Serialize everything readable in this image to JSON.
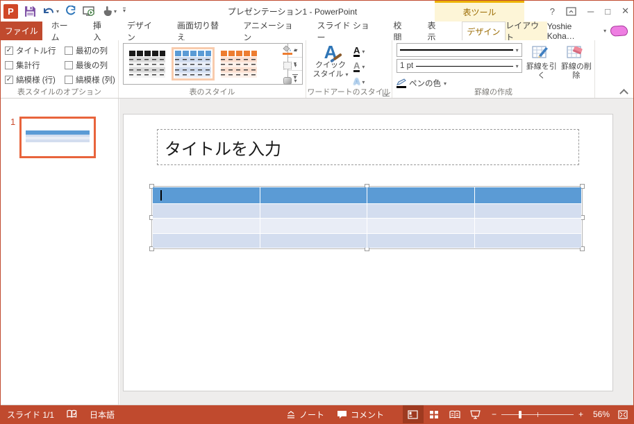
{
  "window": {
    "title": "プレゼンテーション1 - PowerPoint",
    "contextual_title": "表ツール",
    "user_name": "Yoshie Koha…",
    "controls": {
      "help": "?",
      "minimize": "─",
      "maximize": "□",
      "close": "✕"
    }
  },
  "icons": {
    "app": "P",
    "dropdown_arrow": "▾",
    "gallery_up": "▲",
    "gallery_down": "▼",
    "gallery_more": "▼"
  },
  "tabs": {
    "file": "ファイル",
    "items": [
      "ホーム",
      "挿入",
      "デザイン",
      "画面切り替え",
      "アニメーション",
      "スライド ショー",
      "校閲",
      "表示"
    ],
    "contextual_design": "デザイン",
    "contextual_layout": "レイアウト"
  },
  "ribbon": {
    "table_style_options": {
      "label": "表スタイルのオプション",
      "checkboxes": [
        {
          "label": "タイトル行",
          "glyph": "✓"
        },
        {
          "label": "最初の列",
          "glyph": ""
        },
        {
          "label": "集計行",
          "glyph": ""
        },
        {
          "label": "最後の列",
          "glyph": ""
        },
        {
          "label": "縞模様 (行)",
          "glyph": "✓"
        },
        {
          "label": "縞模様 (列)",
          "glyph": ""
        }
      ]
    },
    "table_styles": {
      "label": "表のスタイル",
      "styles": [
        {
          "name": "table-style-dark",
          "header": "#1a1a1a",
          "row_a": "#d9d9d9",
          "row_b": "#f4f4f4",
          "selected": false
        },
        {
          "name": "table-style-blue",
          "header": "#5b9bd5",
          "row_a": "#cfdbee",
          "row_b": "#e9eef8",
          "selected": true
        },
        {
          "name": "table-style-orange",
          "header": "#ed7d31",
          "row_a": "#fbdfd0",
          "row_b": "#fdf1ea",
          "selected": false
        }
      ]
    },
    "wordart": {
      "label": "ワードアートのスタイル",
      "quick_style": "クイック スタイル"
    },
    "draw_borders": {
      "label": "罫線の作成",
      "pen_weight": "1 pt",
      "pen_color": "ペンの色",
      "draw_table": "罫線を引く",
      "eraser": "罫線の削除"
    }
  },
  "slide_panel": {
    "slide_number": "1"
  },
  "slide": {
    "title_placeholder": "タイトルを入力",
    "table": {
      "columns": 4,
      "rows": 4,
      "header_color": "#5b9bd5",
      "band_colors": [
        "#d3ddef",
        "#e9edf6"
      ]
    }
  },
  "status_bar": {
    "slide_indicator": "スライド 1/1",
    "language": "日本語",
    "notes": "ノート",
    "comments": "コメント",
    "zoom_level": "56%"
  }
}
